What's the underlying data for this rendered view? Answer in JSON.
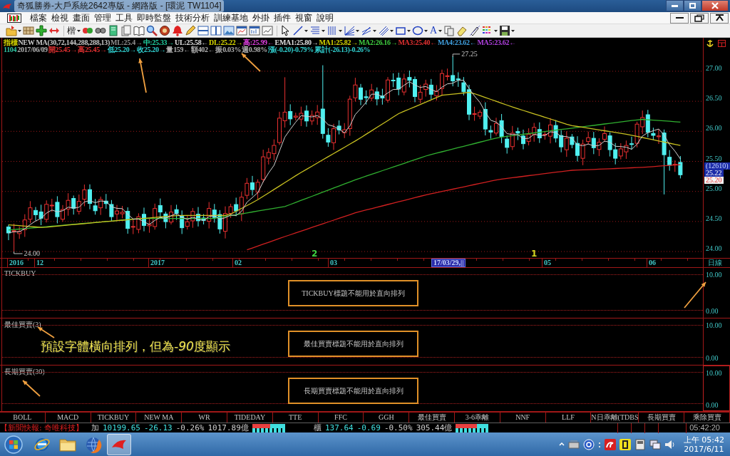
{
  "window": {
    "title": "奇狐勝券-大戶系統2642專版 - 網路版 - [環泥 TW1104]"
  },
  "menu": [
    "檔案",
    "檢視",
    "畫面",
    "管理",
    "工具",
    "即時監盤",
    "技術分析",
    "訓練基地",
    "外掛",
    "插件",
    "視窗",
    "說明"
  ],
  "toolbar": {
    "font_button": "楷",
    "text_tool": "A"
  },
  "chart": {
    "header_line_1": [
      {
        "text": "指標",
        "color": "#d8d800"
      },
      {
        "text": "NEW MA(30,72,144,288,288,13)",
        "color": "#c8c8c8"
      },
      {
        "text": "ML:25.4→",
        "color": "#909090"
      },
      {
        "text": "中:25.33→",
        "color": "#20d0a0"
      },
      {
        "text": "UL:25.58←",
        "color": "#e0e0e0"
      },
      {
        "text": "DL:25.22→",
        "color": "#d8d800"
      },
      {
        "text": "高:25.99←",
        "color": "#e040e0"
      },
      {
        "text": "EMA1:25.80→",
        "color": "#e0e0e0"
      },
      {
        "text": "MA1:25.82→",
        "color": "#d8d800"
      },
      {
        "text": "MA2:26.16→",
        "color": "#40d040"
      },
      {
        "text": "MA3:25.40←",
        "color": "#e03030"
      },
      {
        "text": "MA4:23.62←",
        "color": "#40a0e0"
      },
      {
        "text": "MA5:23.62←",
        "color": "#b040e0"
      }
    ],
    "header_line_2": [
      {
        "text": "1104",
        "color": "#30c0a0"
      },
      {
        "text": "2017/06/09",
        "color": "#b0b0b0"
      },
      {
        "text": "開25.45→",
        "color": "#e03030"
      },
      {
        "text": "高25.45→",
        "color": "#e03030"
      },
      {
        "text": "低25.20→",
        "color": "#30d0d0"
      },
      {
        "text": "收25.20→",
        "color": "#30d0d0"
      },
      {
        "text": "量159←",
        "color": "#b0b0b0"
      },
      {
        "text": "額402←",
        "color": "#b0b0b0"
      },
      {
        "text": "振0.03%",
        "color": "#b0b0b0"
      },
      {
        "text": "週0.98%",
        "color": "#b0b0b0"
      },
      {
        "text": "漲(-0.20)-0.79%",
        "color": "#30d0d0"
      },
      {
        "text": "累計(-26.13)-0.26%",
        "color": "#30d0d0"
      }
    ],
    "peak_label": "27.25",
    "low_label": "24.00",
    "wave_marks": [
      {
        "text": "2",
        "color": "#40d040"
      },
      {
        "text": "1",
        "color": "#d8d820"
      }
    ],
    "price_axis": [
      "27.00",
      "26.50",
      "26.00",
      "25.50",
      "25.00",
      "24.50",
      "24.00"
    ],
    "price_tags": [
      {
        "text": "(12610)",
        "kind": "volume"
      },
      {
        "text": "25.22",
        "kind": "cursor"
      },
      {
        "text": "25.20",
        "kind": "close"
      }
    ],
    "date_axis": [
      {
        "text": "2016",
        "kind": "tick"
      },
      {
        "text": "12",
        "kind": "tick"
      },
      {
        "text": "2017",
        "kind": "tick"
      },
      {
        "text": "02",
        "kind": "tick"
      },
      {
        "text": "03",
        "kind": "tick"
      },
      {
        "text": "17/03/29,||",
        "kind": "cursor"
      },
      {
        "text": "05",
        "kind": "tick"
      },
      {
        "text": "06",
        "kind": "tick"
      }
    ],
    "period": "日線"
  },
  "panels": [
    {
      "title": "TICKBUY",
      "notice": "TICKBUY標題不能用於直向排列",
      "axis": [
        "10.00",
        "0.00"
      ]
    },
    {
      "title": "最佳買賣(3)",
      "notice": "最佳買賣標題不能用於直向排列",
      "axis": [
        "10.00",
        "0.00"
      ]
    },
    {
      "title": "長期買賣(30)",
      "notice": "長期買賣標題不能用於直向排列",
      "axis": [
        "10.00",
        "0.00"
      ]
    }
  ],
  "annotation": [
    {
      "text": "預設字體橫向排列，但為",
      "italic": false
    },
    {
      "text": "-90",
      "italic": true
    },
    {
      "text": "度顯示",
      "italic": false
    }
  ],
  "tabs": [
    "BOLL",
    "MACD",
    "TICKBUY",
    "NEW MA",
    "WR",
    "TIDEDAY",
    "TTE",
    "FFC",
    "GGH",
    "最佳買賣",
    "3-6乖離",
    "NNF",
    "LLF",
    "N日乖離(TDBS",
    "長期買賣",
    "乘除買賣"
  ],
  "status_bar": {
    "news": "【新聞快報: 奇唯科技】",
    "markets": [
      {
        "name": "加",
        "index": "10199.65",
        "change": "-26.13",
        "percent": "-0.26%",
        "volume": "1017.89億",
        "level": 0.55
      },
      {
        "name": "櫃",
        "index": "137.64",
        "change": "-0.69",
        "percent": "-0.50%",
        "volume": "305.44億",
        "level": 0.65
      }
    ],
    "time": "05:42:20"
  },
  "taskbar": {
    "apps": [
      {
        "kind": "browser-e",
        "selected": false
      },
      {
        "kind": "folder",
        "selected": false
      },
      {
        "kind": "browser-fox",
        "selected": false
      },
      {
        "kind": "trading",
        "selected": true
      }
    ],
    "clock_time": "上午 05:42",
    "clock_date": "2017/6/11"
  }
}
